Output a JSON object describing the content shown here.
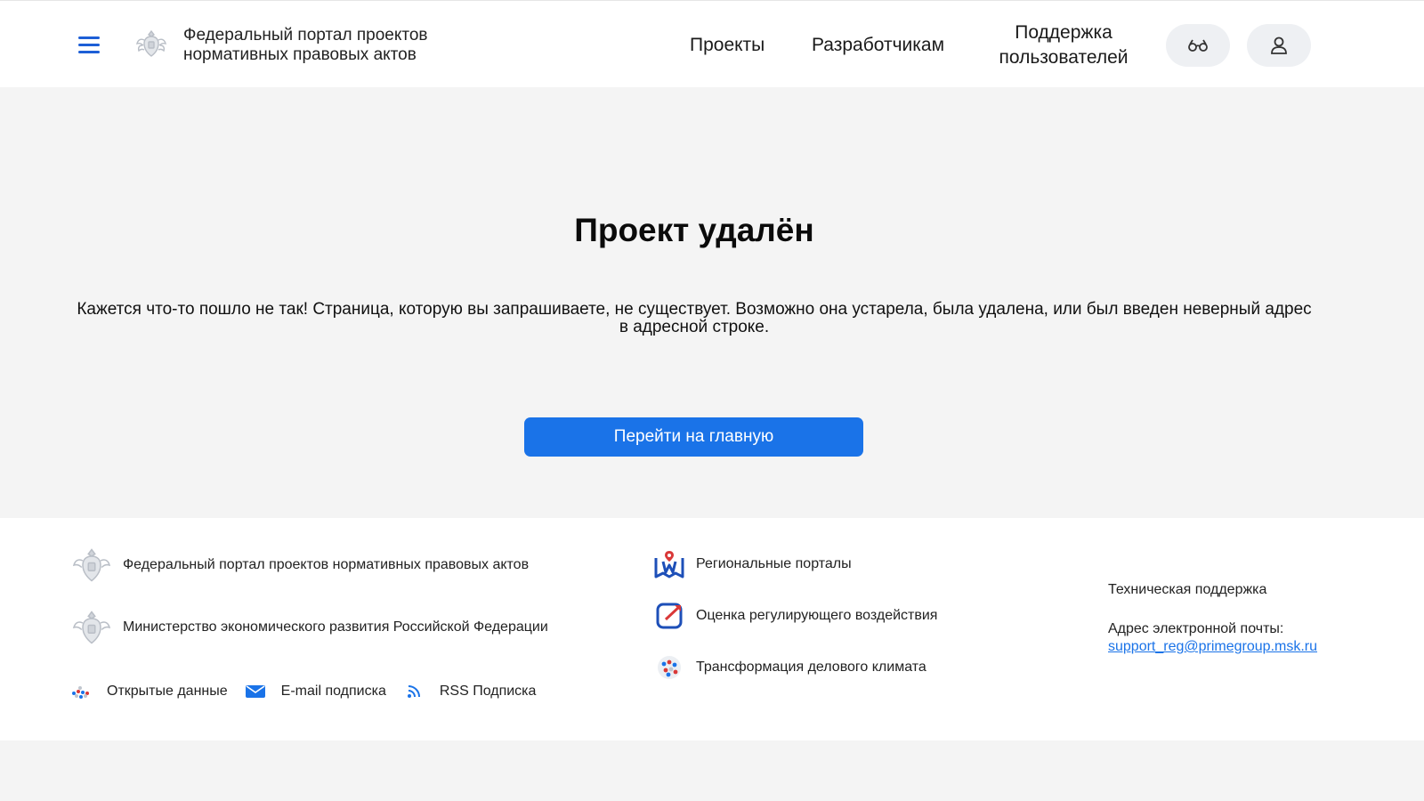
{
  "header": {
    "portal_line1": "Федеральный портал проектов",
    "portal_line2": "нормативных правовых актов",
    "nav": {
      "projects": "Проекты",
      "developers": "Разработчикам",
      "support_line1": "Поддержка",
      "support_line2": "пользователей"
    },
    "icons": {
      "menu": "hamburger-menu-icon",
      "emblem": "coat-of-arms-icon",
      "accessibility": "glasses-icon",
      "profile": "user-icon"
    }
  },
  "main": {
    "title": "Проект удалён",
    "message_line1": "Кажется что-то пошло не так! Страница, которую вы запрашиваете, не существует. Возможно она устарела, была удалена, или был введен неверный адрес",
    "message_line2": "в адресной строке.",
    "home_button": "Перейти на главную"
  },
  "footer": {
    "portal": "Федеральный портал проектов нормативных правовых актов",
    "ministry": "Министерство экономического развития Российской Федерации",
    "open_data": "Открытые данные",
    "email_subscription": "E-mail подписка",
    "rss_subscription": "RSS Подписка",
    "regional_portals": "Региональные порталы",
    "regulatory_impact": "Оценка регулирующего воздействия",
    "business_climate": "Трансформация делового климата",
    "tech_support": "Техническая поддержка",
    "email_label": "Адрес электронной почты:",
    "email": "support_reg@primegroup.msk.ru"
  },
  "colors": {
    "accent": "#1a73e8",
    "menu_icon": "#1d5fd6",
    "background": "#f4f4f4",
    "surface": "#ffffff",
    "icon_button_bg": "#eef0f3"
  }
}
